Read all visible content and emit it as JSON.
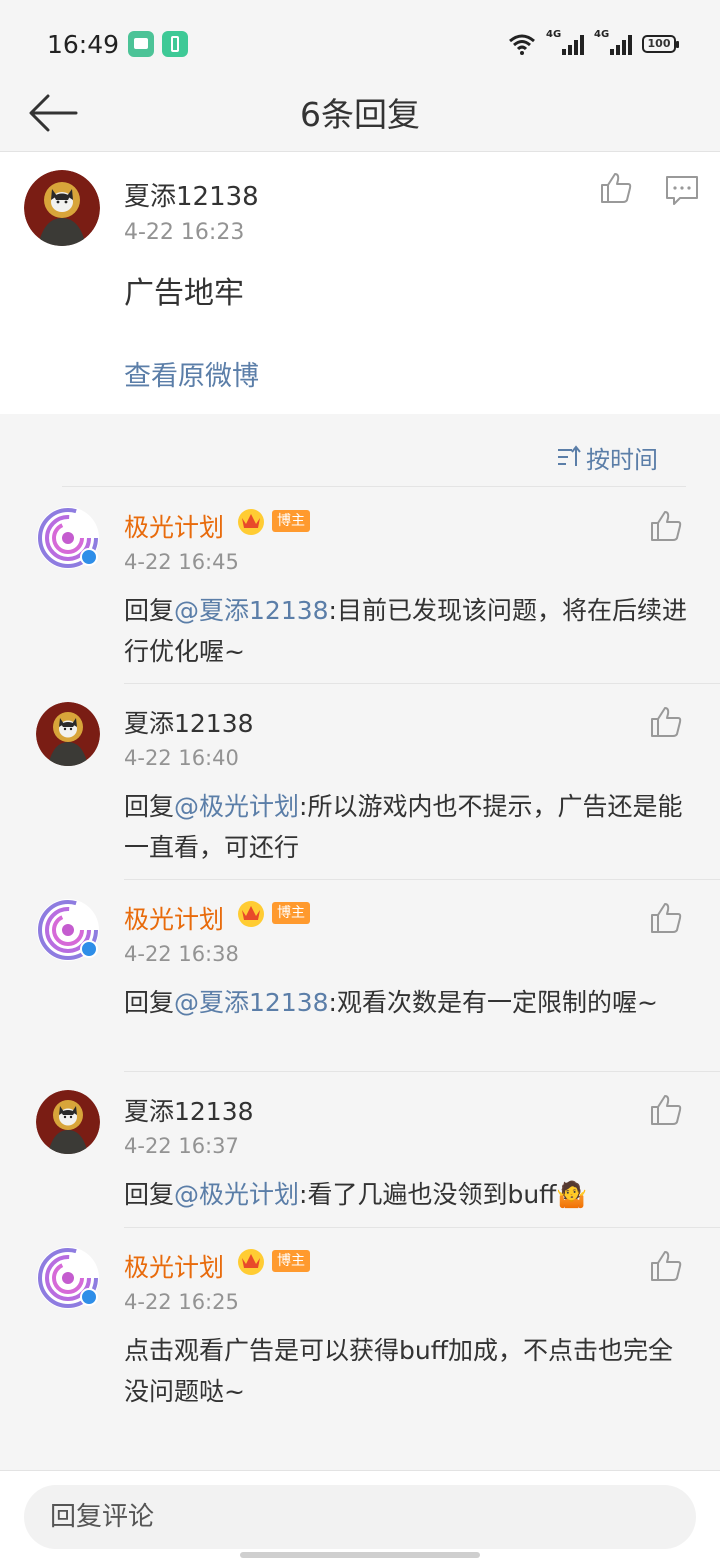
{
  "status_bar": {
    "time": "16:49",
    "network_1": "4G",
    "network_2": "4G",
    "battery": "100"
  },
  "header": {
    "title": "6条回复"
  },
  "main_comment": {
    "username": "夏添12138",
    "timestamp": "4-22 16:23",
    "content": "广告地牢",
    "view_original": "查看原微博"
  },
  "sort": {
    "label": "按时间"
  },
  "replies": [
    {
      "username": "极光计划",
      "role_badge": "博主",
      "timestamp": "4-22 16:45",
      "prefix": "回复",
      "mention": "@夏添12138",
      "text": ":目前已发现该问题，将在后续进行优化喔~"
    },
    {
      "username": "夏添12138",
      "timestamp": "4-22 16:40",
      "prefix": "回复",
      "mention": "@极光计划",
      "text": ":所以游戏内也不提示，广告还是能一直看，可还行"
    },
    {
      "username": "极光计划",
      "role_badge": "博主",
      "timestamp": "4-22 16:38",
      "prefix": "回复",
      "mention": "@夏添12138",
      "text": ":观看次数是有一定限制的喔~"
    },
    {
      "username": "夏添12138",
      "timestamp": "4-22 16:37",
      "prefix": "回复",
      "mention": "@极光计划",
      "text": ":看了几遍也没领到buff",
      "emoji": "🤷"
    },
    {
      "username": "极光计划",
      "role_badge": "博主",
      "timestamp": "4-22 16:25",
      "text": "点击观看广告是可以获得buff加成，不点击也完全没问题哒~"
    }
  ],
  "bottom": {
    "input_placeholder": "回复评论"
  },
  "colors": {
    "link": "#5b7ea8",
    "blogger_name": "#e86b0c",
    "badge": "#ff9a2e",
    "background": "#f5f5f5"
  },
  "icons": {
    "back": "arrow-left-icon",
    "like": "thumbs-up-icon",
    "reply": "comment-icon",
    "sort": "sort-icon",
    "vip": "crown-icon",
    "verified": "verified-icon"
  }
}
